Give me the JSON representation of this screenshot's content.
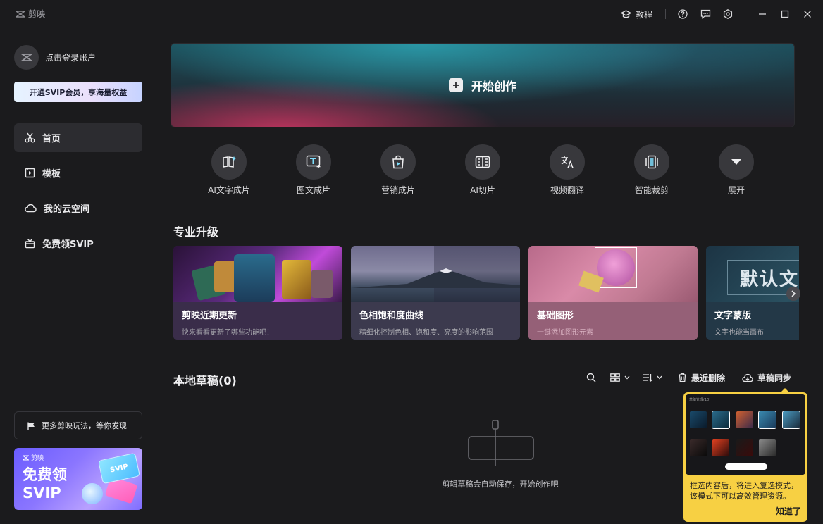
{
  "titlebar": {
    "logo_text": "剪映",
    "tutorial_label": "教程"
  },
  "sidebar": {
    "login_label": "点击登录账户",
    "svip_bar_label": "开通SVIP会员，享海量权益",
    "nav": [
      {
        "label": "首页",
        "icon": "scissors-icon",
        "active": true
      },
      {
        "label": "模板",
        "icon": "template-icon",
        "active": false
      },
      {
        "label": "我的云空间",
        "icon": "cloud-icon",
        "active": false
      },
      {
        "label": "免费领SVIP",
        "icon": "gift-icon",
        "active": false
      }
    ],
    "more_label": "更多剪映玩法，等你发现",
    "promo": {
      "brand": "剪映",
      "line1": "免费领",
      "line2": "SVIP",
      "card_text": "SVIP"
    }
  },
  "hero": {
    "label": "开始创作"
  },
  "tools": [
    {
      "label": "AI文字成片",
      "icon": "ai-text-video-icon"
    },
    {
      "label": "图文成片",
      "icon": "image-text-video-icon"
    },
    {
      "label": "营销成片",
      "icon": "marketing-bag-icon"
    },
    {
      "label": "AI切片",
      "icon": "ai-slice-icon"
    },
    {
      "label": "视频翻译",
      "icon": "translate-icon"
    },
    {
      "label": "智能裁剪",
      "icon": "smart-crop-icon"
    },
    {
      "label": "展开",
      "icon": "expand-chevron-icon"
    }
  ],
  "upgrade": {
    "title": "专业升级",
    "cards": [
      {
        "title": "剪映近期更新",
        "subtitle": "快来看看更新了哪些功能吧！"
      },
      {
        "title": "色相饱和度曲线",
        "subtitle": "精细化控制色相、饱和度、亮度的影响范围"
      },
      {
        "title": "基础图形",
        "subtitle": "一键添加图形元素"
      },
      {
        "title": "文字蒙版",
        "subtitle": "文字也能当画布",
        "art_text": "默认文"
      }
    ]
  },
  "drafts": {
    "title": "本地草稿(0)",
    "recent_delete": "最近删除",
    "sync": "草稿同步",
    "empty_text": "剪辑草稿会自动保存，开始创作吧"
  },
  "tooltip": {
    "screenshot_title": "草稿管理(10)",
    "text": "框选内容后，将进入复选模式，该模式下可以高效管理资源。",
    "ok_label": "知道了"
  },
  "colors": {
    "background": "#1b1b1d",
    "accent_yellow": "#f7d043",
    "nav_active": "#2c2c30"
  }
}
